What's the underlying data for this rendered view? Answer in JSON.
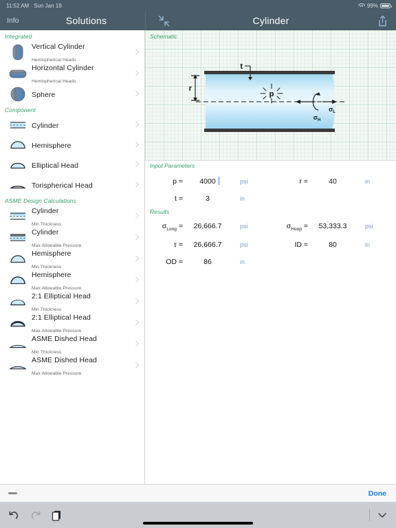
{
  "status_bar": {
    "time": "11:52 AM",
    "date": "Sun Jan 19",
    "battery_percent": "99%",
    "wifi_icon": "wifi-icon",
    "battery_icon": "battery-icon"
  },
  "sidebar_nav": {
    "back_label": "Info",
    "title": "Solutions"
  },
  "detail_nav": {
    "title": "Cylinder",
    "contract_icon": "contract-arrows-icon",
    "share_icon": "share-icon"
  },
  "sidebar": {
    "sections": [
      {
        "header": "Integrated",
        "items": [
          {
            "title": "Vertical Cylinder",
            "subtitle": "Hemispherical Heads",
            "icon": "vertical-cylinder-icon"
          },
          {
            "title": "Horizontal Cylinder",
            "subtitle": "Hemispherical Heads",
            "icon": "horizontal-cylinder-icon"
          },
          {
            "title": "Sphere",
            "subtitle": "",
            "icon": "sphere-icon"
          }
        ]
      },
      {
        "header": "Component",
        "items": [
          {
            "title": "Cylinder",
            "subtitle": "",
            "icon": "cylinder-outline-icon"
          },
          {
            "title": "Hemisphere",
            "subtitle": "",
            "icon": "hemisphere-outline-icon"
          },
          {
            "title": "Elliptical Head",
            "subtitle": "",
            "icon": "elliptical-head-icon"
          },
          {
            "title": "Torispherical Head",
            "subtitle": "",
            "icon": "torispherical-head-icon"
          }
        ]
      },
      {
        "header": "ASME Design Calculations",
        "items": [
          {
            "title": "Cylinder",
            "subtitle": "Min Thickness",
            "icon": "cylinder-min-thickness-icon"
          },
          {
            "title": "Cylinder",
            "subtitle": "Max Allowable Pressure",
            "icon": "cylinder-max-pressure-icon"
          },
          {
            "title": "Hemisphere",
            "subtitle": "Min Thickness",
            "icon": "hemisphere-min-thickness-icon"
          },
          {
            "title": "Hemisphere",
            "subtitle": "Max Allowable Pressure",
            "icon": "hemisphere-max-pressure-icon"
          },
          {
            "title": "2:1 Elliptical Head",
            "subtitle": "Min Thickness",
            "icon": "elliptical-min-thickness-icon"
          },
          {
            "title": "2:1 Elliptical Head",
            "subtitle": "Max Allowable Pressure",
            "icon": "elliptical-max-pressure-icon"
          },
          {
            "title": "ASME Dished Head",
            "subtitle": "Min Thickness",
            "icon": "dished-min-thickness-icon"
          },
          {
            "title": "ASME Dished Head",
            "subtitle": "Max Allowable Pressure",
            "icon": "dished-max-pressure-icon"
          }
        ]
      }
    ],
    "chevron_icon": "chevron-right-icon"
  },
  "main": {
    "schematic_header": "Schematic",
    "schematic_labels": {
      "thickness": "t",
      "radius": "r",
      "pressure": "p",
      "hoop_stress": "σ",
      "hoop_stress_sub": "H",
      "long_stress": "σ",
      "long_stress_sub": "L"
    },
    "input_header": "Input Parameters",
    "inputs": [
      {
        "label": "p =",
        "value": "4000",
        "unit": "psi",
        "editing": true
      },
      {
        "label": "r =",
        "value": "40",
        "unit": "in",
        "editing": false
      },
      {
        "label": "t =",
        "value": "3",
        "unit": "in",
        "editing": false
      }
    ],
    "results_header": "Results",
    "results": [
      {
        "label": "σ",
        "sub": "Long",
        "eq": "=",
        "value": "26,666.7",
        "unit": "psi"
      },
      {
        "label": "σ",
        "sub": "Hoop",
        "eq": "=",
        "value": "53,333.3",
        "unit": "psi"
      },
      {
        "label": "τ",
        "sub": "",
        "eq": "=",
        "value": "26,666.7",
        "unit": "psi"
      },
      {
        "label": "ID",
        "sub": "",
        "eq": "=",
        "value": "80",
        "unit": "in"
      },
      {
        "label": "OD",
        "sub": "",
        "eq": "=",
        "value": "86",
        "unit": "in"
      }
    ]
  },
  "keyboard_bar": {
    "done_label": "Done",
    "undo_icon": "undo-icon",
    "redo_icon": "redo-icon",
    "paste_icon": "paste-icon",
    "dismiss_icon": "chevron-down-icon",
    "handle_icon": "drag-handle-icon"
  },
  "colors": {
    "navbar": "#4a5c68",
    "accent_green": "#35a06a",
    "unit_blue": "#6f9fd0",
    "done_blue": "#1479f0",
    "cylinder_fill": "#bfe4f7"
  }
}
